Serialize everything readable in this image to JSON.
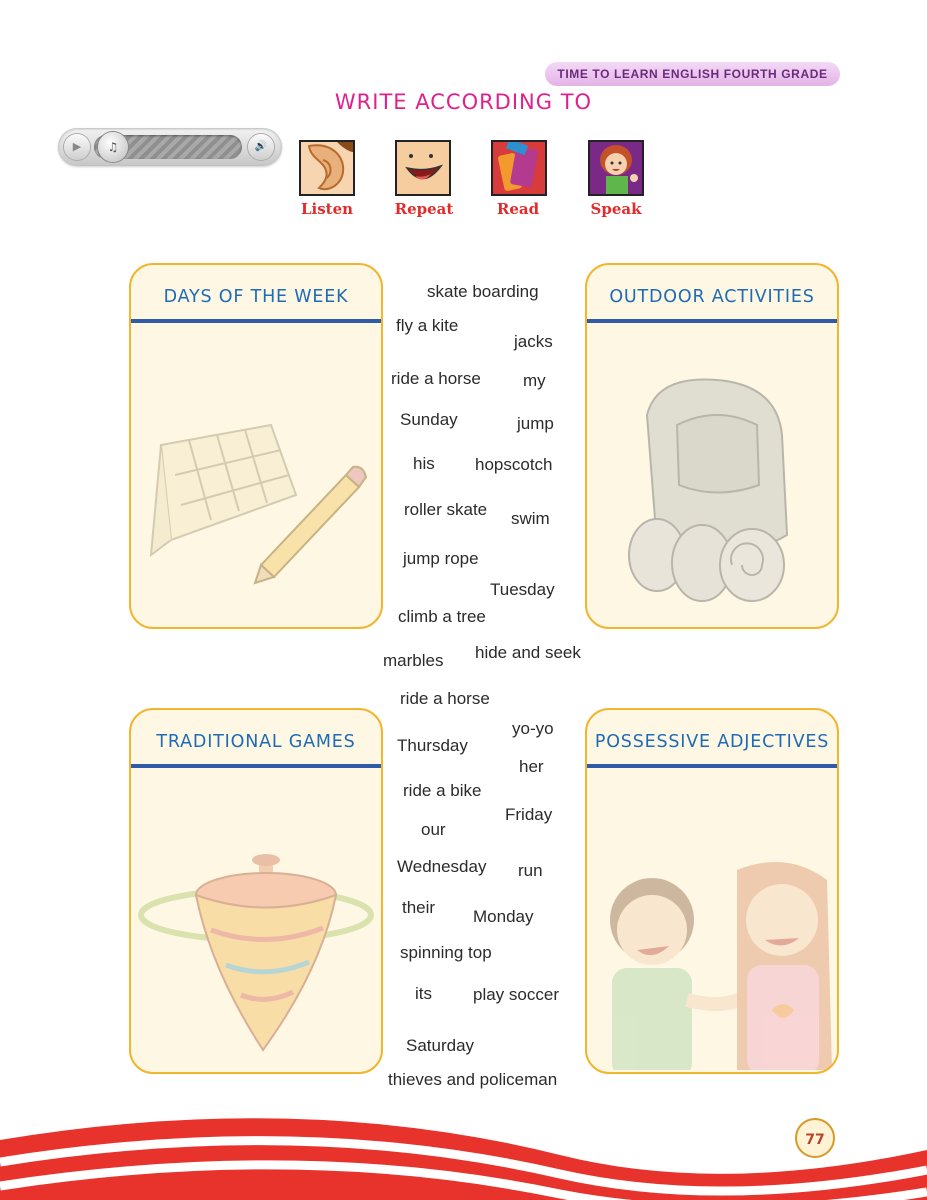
{
  "header": {
    "book_title": "TIME TO LEARN ENGLISH FOURTH GRADE"
  },
  "page_title": "WRITE ACCORDING TO",
  "activities": [
    {
      "label": "Listen",
      "icon": "ear-icon"
    },
    {
      "label": "Repeat",
      "icon": "mouth-icon"
    },
    {
      "label": "Read",
      "icon": "book-icon"
    },
    {
      "label": "Speak",
      "icon": "girl-speaking-icon"
    }
  ],
  "cards": [
    {
      "title": "DAYS OF THE WEEK",
      "icon": "calendar-pencil-icon"
    },
    {
      "title": "OUTDOOR ACTIVITIES",
      "icon": "backpack-icon"
    },
    {
      "title": "TRADITIONAL GAMES",
      "icon": "spinning-top-icon"
    },
    {
      "title": "POSSESSIVE ADJECTIVES",
      "icon": "boy-girl-icon"
    }
  ],
  "words": [
    "skate boarding",
    "fly a kite",
    "jacks",
    "ride a horse",
    "my",
    "Sunday",
    "jump",
    "his",
    "hopscotch",
    "roller skate",
    "swim",
    "jump rope",
    "Tuesday",
    "climb a tree",
    "marbles",
    "hide and seek",
    "ride a horse",
    "yo-yo",
    "Thursday",
    "her",
    "ride a bike",
    "Friday",
    "our",
    "Wednesday",
    "run",
    "their",
    "Monday",
    "spinning top",
    "its",
    "play soccer",
    "Saturday",
    "thieves and policeman"
  ],
  "page_number": "77",
  "colors": {
    "title_pink": "#e0218a",
    "card_blue": "#1f6bb5",
    "card_border": "#f1b52e",
    "label_red": "#e32b2b",
    "wave_red": "#e8332d"
  }
}
